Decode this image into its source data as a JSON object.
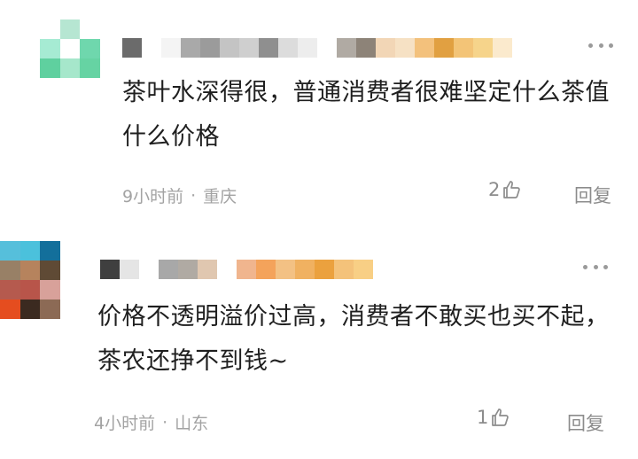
{
  "comments": [
    {
      "avatar_pixels": [
        "#ffffff",
        "#b6e6d2",
        "#ffffff",
        "#a6ebd3",
        "#ffffff",
        "#6fd7ad",
        "#5fd09f",
        "#a6e7cb",
        "#66d3a3"
      ],
      "username_pixels": [
        "#6b6b6b",
        "#ffffff",
        "#f4f4f4",
        "#a9a9a9",
        "#9b9b9b",
        "#c4c4c4",
        "#cfcfcf",
        "#8f8f8f",
        "#dcdcdc",
        "#ededed",
        "#ffffff",
        "#b0aaa3",
        "#8d8378",
        "#f2d6b6",
        "#f6e1c4",
        "#f3c17c",
        "#e1a041",
        "#f3c477",
        "#f6d48b",
        "#fbeacd"
      ],
      "text": "茶叶水深得很，普通消费者很难坚定什么茶值什么价格",
      "time": "9小时前",
      "dot": "·",
      "location": "重庆",
      "likes": "2",
      "reply_label": "回复"
    },
    {
      "avatar_pixels": [
        "#56bfdb",
        "#4bc1dc",
        "#136f9b",
        "#988066",
        "#b6835d",
        "#5f4a35",
        "#b55a4e",
        "#b8554a",
        "#d8a19a",
        "#e54d1f",
        "#3b2a20",
        "#8c6a55"
      ],
      "username_pixels": [
        "#3f3f3f",
        "#e5e5e5",
        "#ffffff",
        "#a8a8a8",
        "#b0aaa3",
        "#e0c7b0",
        "#ffffff",
        "#f0b58e",
        "#f4a35b",
        "#f3c184",
        "#f0b161",
        "#eba13e",
        "#f4c27a",
        "#f8cf85"
      ],
      "text": "价格不透明溢价过高，消费者不敢买也买不起，茶农还挣不到钱~",
      "time": "4小时前",
      "dot": "·",
      "location": "山东",
      "likes": "1",
      "reply_label": "回复"
    }
  ],
  "colors": {
    "text": "#1f1f1f",
    "meta": "#a3a3a3",
    "action": "#8c8c8c"
  },
  "icons": {
    "more": "more-dots-icon",
    "like": "thumbs-up-icon"
  }
}
